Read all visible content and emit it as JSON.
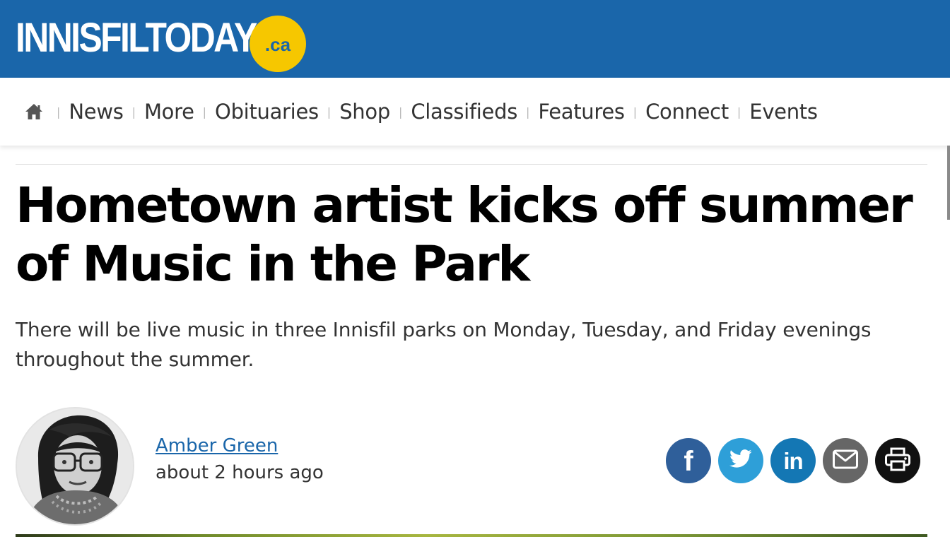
{
  "site": {
    "logo_text": "INNISFILTODAY",
    "logo_badge": ".ca",
    "colors": {
      "brand_blue": "#1a66aa",
      "brand_yellow": "#f6c700"
    }
  },
  "nav": {
    "home_icon": "home-icon",
    "separator": "|",
    "items": [
      "News",
      "More",
      "Obituaries",
      "Shop",
      "Classifieds",
      "Features",
      "Connect",
      "Events"
    ]
  },
  "article": {
    "headline": "Hometown artist kicks off summer of Music in the Park",
    "subheadline": "There will be live music in three Innisfil parks on Monday, Tuesday, and Friday evenings throughout the summer.",
    "author": "Amber Green",
    "timestamp": "about 2 hours ago"
  },
  "share": {
    "buttons": [
      {
        "icon": "facebook-icon",
        "color": "#2f5f9a"
      },
      {
        "icon": "twitter-icon",
        "color": "#2e9fd8"
      },
      {
        "icon": "linkedin-icon",
        "color": "#1477b4"
      },
      {
        "icon": "email-icon",
        "color": "#666666"
      },
      {
        "icon": "print-icon",
        "color": "#111111"
      }
    ]
  }
}
